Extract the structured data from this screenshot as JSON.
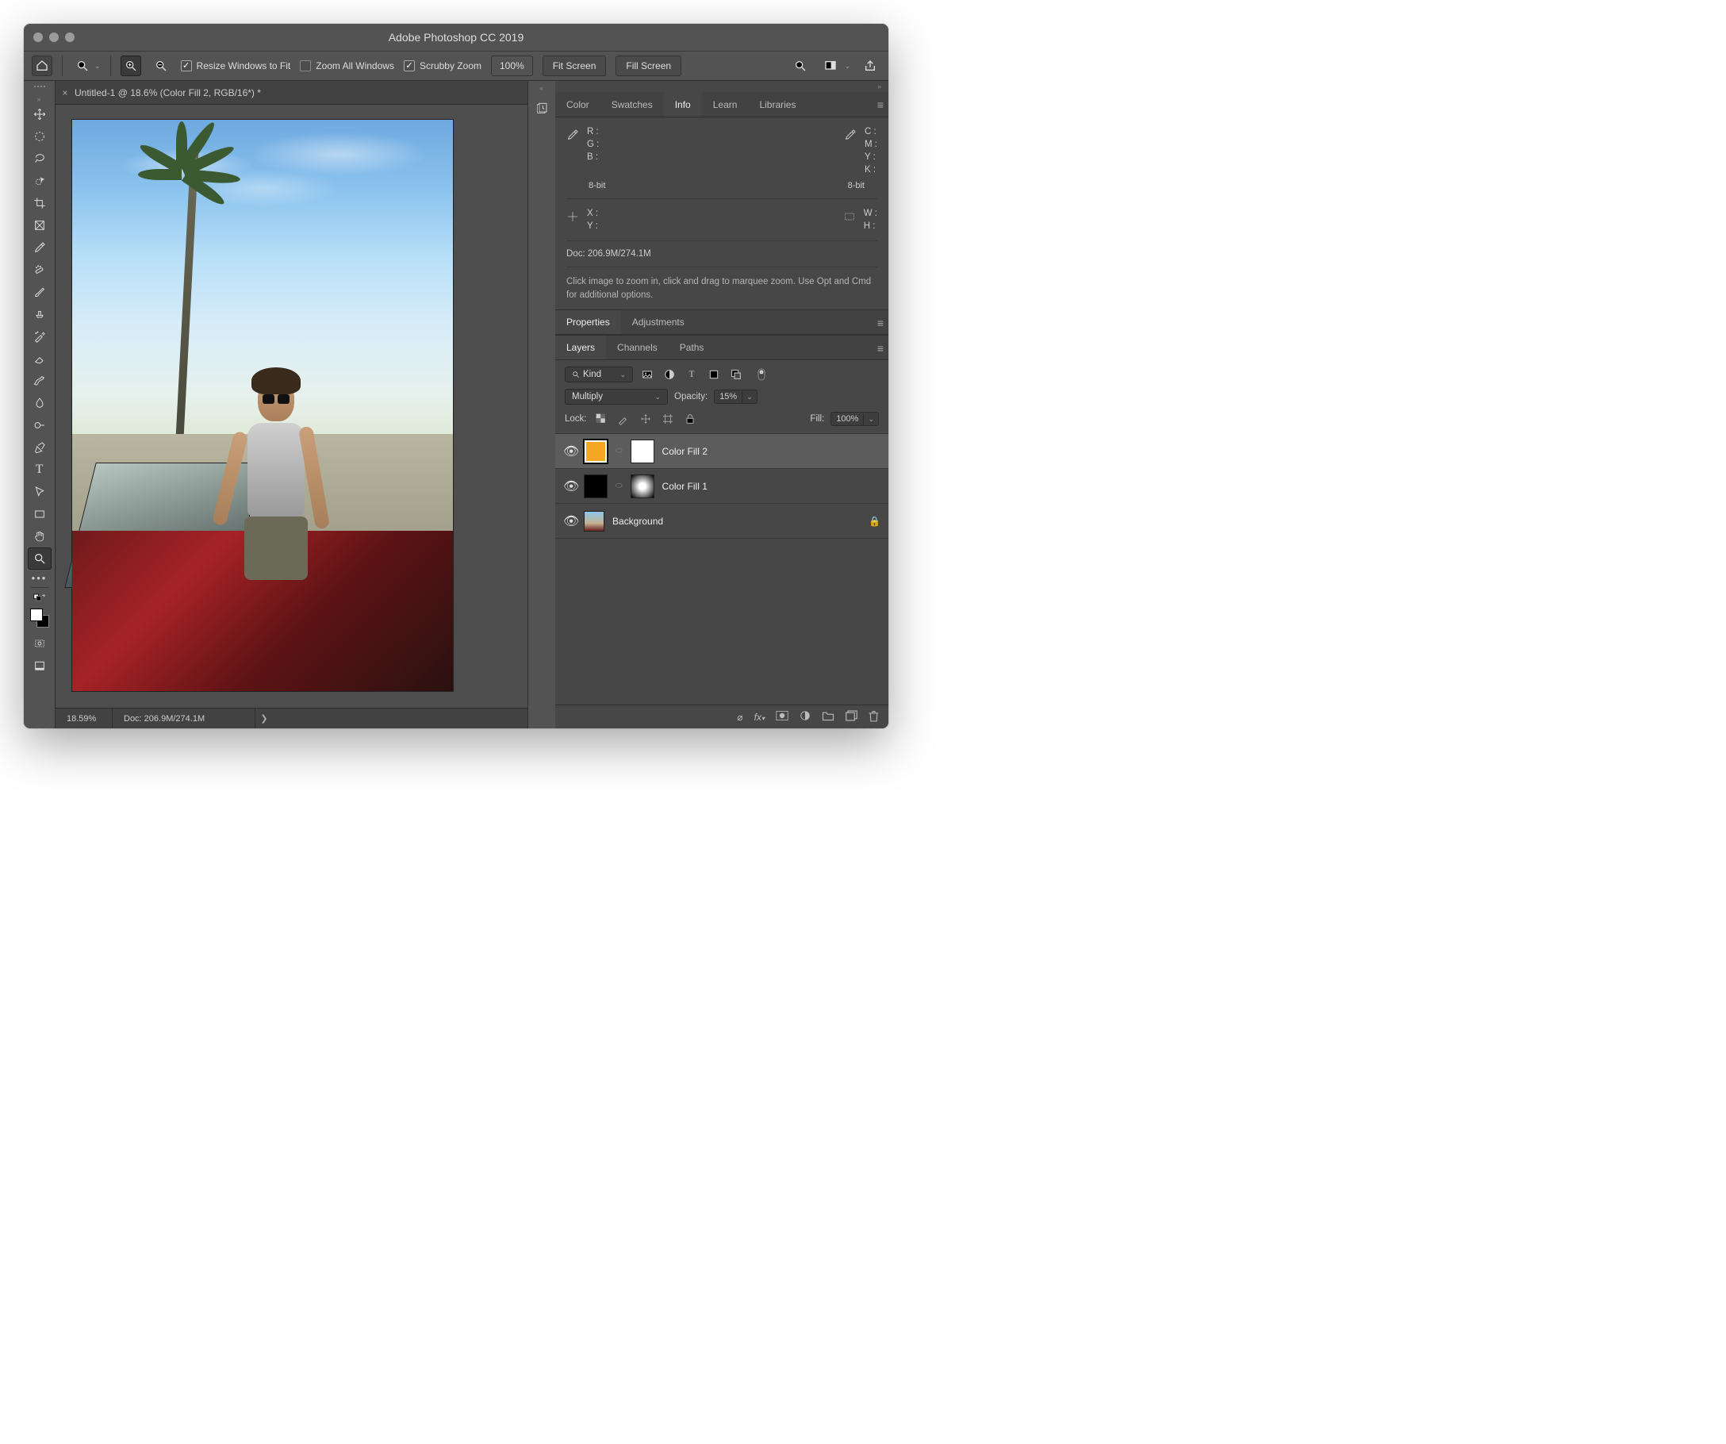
{
  "app_title": "Adobe Photoshop CC 2019",
  "options": {
    "resize_label": "Resize Windows to Fit",
    "zoom_all_label": "Zoom All Windows",
    "scrubby_label": "Scrubby Zoom",
    "zoom_value": "100%",
    "fit_screen": "Fit Screen",
    "fill_screen": "Fill Screen"
  },
  "document": {
    "tab_title": "Untitled-1 @ 18.6% (Color Fill 2, RGB/16*) *",
    "status_zoom": "18.59%",
    "status_doc": "Doc: 206.9M/274.1M"
  },
  "info_panel": {
    "tabs": [
      "Color",
      "Swatches",
      "Info",
      "Learn",
      "Libraries"
    ],
    "active": "Info",
    "rgb": {
      "R": "R :",
      "G": "G :",
      "B": "B :"
    },
    "cmyk": {
      "C": "C :",
      "M": "M :",
      "Y": "Y :",
      "K": "K :"
    },
    "bits1": "8-bit",
    "bits2": "8-bit",
    "xy": {
      "X": "X :",
      "Y": "Y :"
    },
    "wh": {
      "W": "W :",
      "H": "H :"
    },
    "doc": "Doc: 206.9M/274.1M",
    "hint": "Click image to zoom in, click and drag to marquee zoom.  Use Opt and Cmd for additional options."
  },
  "prop_panel": {
    "tabs": [
      "Properties",
      "Adjustments"
    ],
    "active": "Properties"
  },
  "layer_panel": {
    "tabs": [
      "Layers",
      "Channels",
      "Paths"
    ],
    "active": "Layers",
    "kind": "Kind",
    "blend": "Multiply",
    "opacity_label": "Opacity:",
    "opacity_value": "15%",
    "lock_label": "Lock:",
    "fill_label": "Fill:",
    "fill_value": "100%",
    "layers": [
      {
        "name": "Color Fill 2",
        "selected": true,
        "thumb": "orange",
        "mask": "mask"
      },
      {
        "name": "Color Fill 1",
        "selected": false,
        "thumb": "black",
        "mask": "maskgrad"
      },
      {
        "name": "Background",
        "selected": false,
        "thumb": "mini",
        "locked": true
      }
    ]
  }
}
